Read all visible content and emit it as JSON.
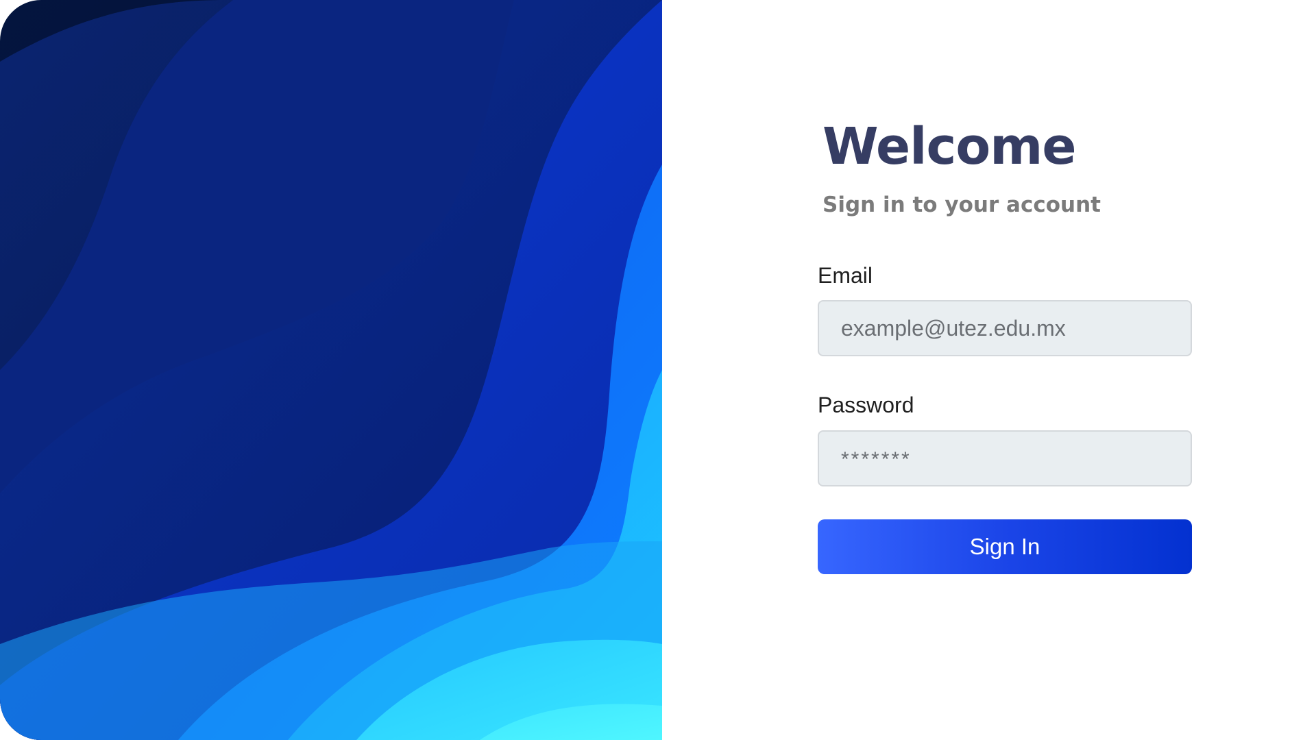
{
  "login": {
    "title": "Welcome",
    "subtitle": "Sign in to your account",
    "email_label": "Email",
    "email_placeholder": "example@utez.edu.mx",
    "password_label": "Password",
    "password_value": "*******",
    "submit_label": "Sign In"
  },
  "colors": {
    "title": "#363d63",
    "subtitle": "#7b7b7b",
    "input_bg": "#e9eef1",
    "button_start": "#3766ff",
    "button_end": "#0331d0",
    "hero_dark": "#061340",
    "hero_light": "#4af1ff"
  },
  "hero": {
    "image": "abstract-blue-waves"
  }
}
